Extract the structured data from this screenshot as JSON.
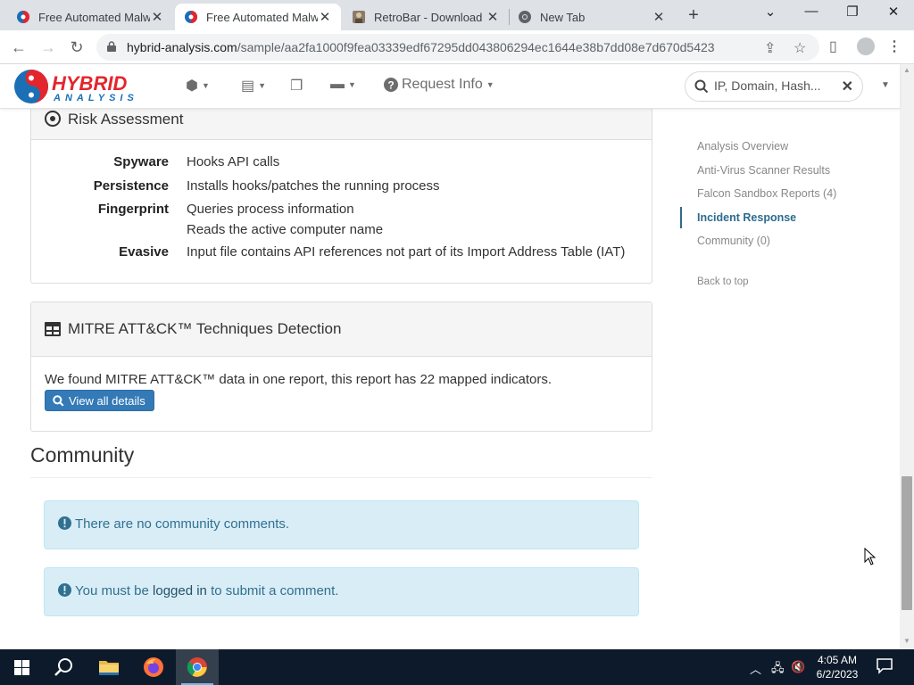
{
  "browser": {
    "tabs": [
      {
        "title": "Free Automated Malwa",
        "icon": "hybrid-analysis-favicon",
        "active": false
      },
      {
        "title": "Free Automated Malwa",
        "icon": "hybrid-analysis-favicon",
        "active": true
      },
      {
        "title": "RetroBar - Download",
        "icon": "retrobar-favicon",
        "active": false
      },
      {
        "title": "New Tab",
        "icon": "chrome-favicon",
        "active": false
      }
    ],
    "url_host": "hybrid-analysis.com",
    "url_path": "/sample/aa2fa1000f9fea03339edf67295dd043806294ec1644e38b7dd08e7d670d5423"
  },
  "site": {
    "logo_top": "HYBRID",
    "logo_bottom": "ANALYSIS",
    "nav": {
      "request_info": "Request Info"
    },
    "search_placeholder": "IP, Domain, Hash..."
  },
  "risk": {
    "title": "Risk Assessment",
    "rows": [
      {
        "label": "Spyware",
        "values": [
          "Hooks API calls"
        ]
      },
      {
        "label": "Persistence",
        "values": [
          "Installs hooks/patches the running process"
        ]
      },
      {
        "label": "Fingerprint",
        "values": [
          "Queries process information",
          "Reads the active computer name"
        ]
      },
      {
        "label": "Evasive",
        "values": [
          "Input file contains API references not part of its Import Address Table (IAT)"
        ]
      }
    ]
  },
  "mitre": {
    "title": "MITRE ATT&CK™ Techniques Detection",
    "text": "We found MITRE ATT&CK™ data in one report, this report has 22 mapped indicators.",
    "button": "View all details"
  },
  "community": {
    "title": "Community",
    "no_comments": "There are no community comments.",
    "login_prefix": "You must be ",
    "login_link": "logged in",
    "login_suffix": " to submit a comment."
  },
  "toc": {
    "items": [
      {
        "label": "Analysis Overview",
        "active": false
      },
      {
        "label": "Anti-Virus Scanner Results",
        "active": false
      },
      {
        "label": "Falcon Sandbox Reports (4)",
        "active": false
      },
      {
        "label": "Incident Response",
        "active": true
      },
      {
        "label": "Community (0)",
        "active": false
      }
    ],
    "back_to_top": "Back to top"
  },
  "taskbar": {
    "time": "4:05 AM",
    "date": "6/2/2023"
  },
  "colors": {
    "brand_red": "#e3262d",
    "brand_blue": "#1a6fb5",
    "primary_button": "#337ab7",
    "alert_bg": "#d9edf7",
    "toc_active": "#2e6b8e"
  }
}
